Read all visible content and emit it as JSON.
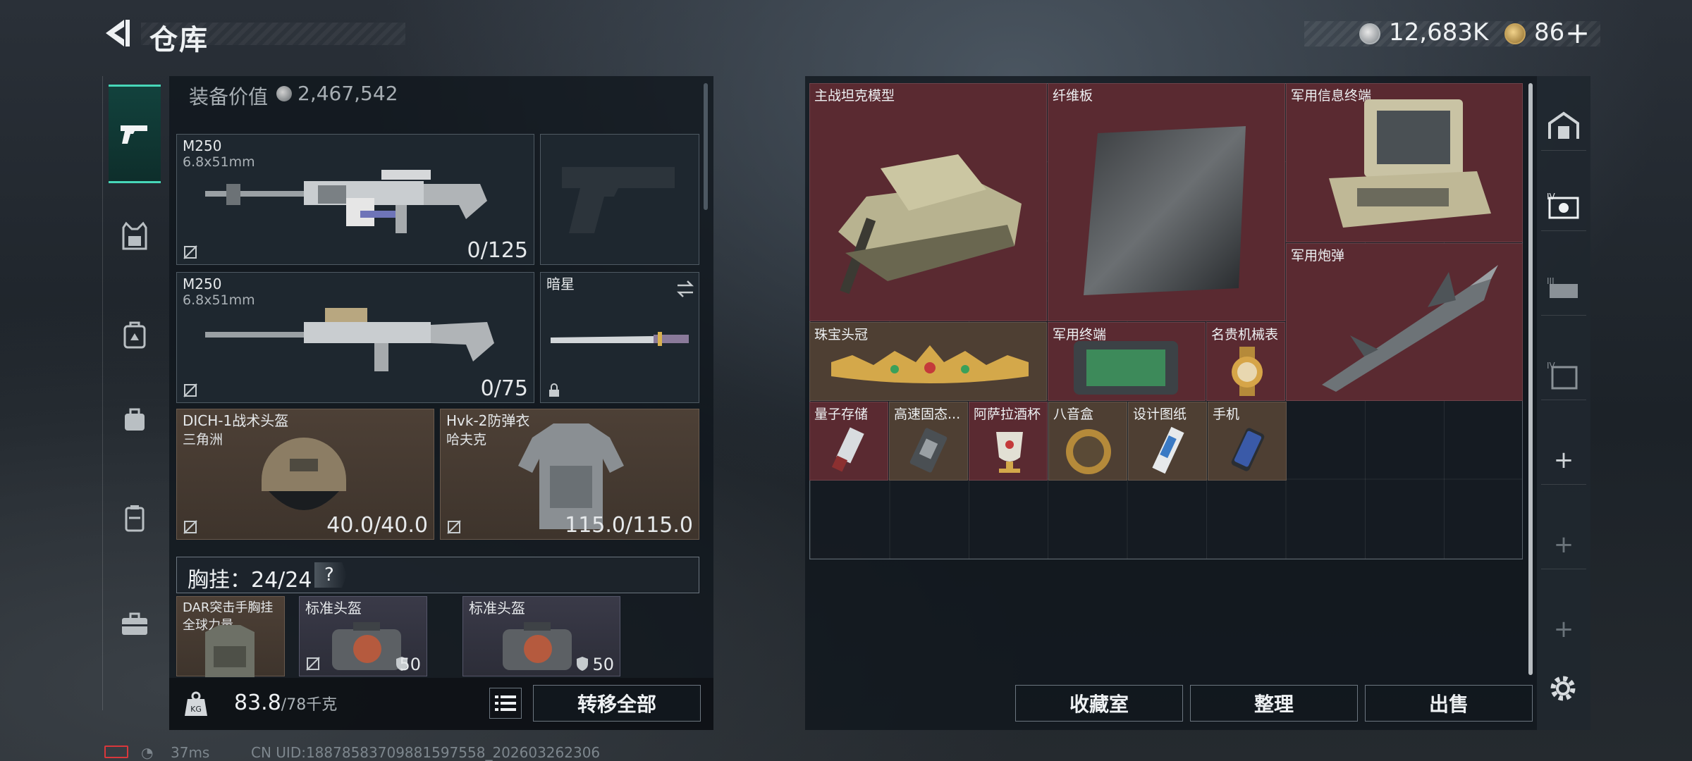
{
  "header": {
    "title": "仓库",
    "silver_amount": "12,683K",
    "gold_amount": "86",
    "plus_label": "+"
  },
  "left_nav": {
    "items": [
      "weapon",
      "vest",
      "backpack",
      "bag",
      "case",
      "toolbox"
    ],
    "active": "weapon"
  },
  "equipment": {
    "value_label": "装备价值",
    "value": "2,467,542",
    "slots": [
      {
        "name": "M250",
        "ammo": "6.8x51mm",
        "count": "0/125"
      },
      {
        "name": "M250",
        "ammo": "6.8x51mm",
        "count": "0/75"
      },
      {
        "name": "暗星"
      },
      {
        "name": "DICH-1战术头盔",
        "sub": "三角洲",
        "count": "40.0/40.0"
      },
      {
        "name": "Hvk-2防弹衣",
        "sub": "哈夫克",
        "count": "115.0/115.0"
      }
    ],
    "chest": {
      "label": "胸挂：24/24",
      "help": "?"
    },
    "chest_items": [
      {
        "name": "DAR突击手胸挂",
        "sub": "全球力量"
      },
      {
        "name": "标准头盔",
        "count": "50"
      },
      {
        "name": "标准头盔",
        "count": "50"
      }
    ],
    "weight": "83.8",
    "weight_max": "/78千克",
    "transfer_all": "转移全部"
  },
  "stash": {
    "items": [
      {
        "name": "主战坦克模型"
      },
      {
        "name": "纤维板"
      },
      {
        "name": "军用信息终端"
      },
      {
        "name": "军用炮弹"
      },
      {
        "name": "珠宝头冠"
      },
      {
        "name": "军用终端"
      },
      {
        "name": "名贵机械表"
      },
      {
        "name": "量子存储"
      },
      {
        "name": "高速固态..."
      },
      {
        "name": "阿萨拉酒杯"
      },
      {
        "name": "八音盒"
      },
      {
        "name": "设计图纸"
      },
      {
        "name": "手机"
      }
    ],
    "buttons": {
      "collection": "收藏室",
      "arrange": "整理",
      "sell": "出售"
    }
  },
  "status_bar": {
    "ping": "37ms",
    "uid": "CN UID:1887858370988159755​8_202603262306"
  },
  "colors": {
    "accent": "#47d7b8",
    "red_tier": "#5a2a31",
    "gold_tier": "#4e3f33"
  }
}
